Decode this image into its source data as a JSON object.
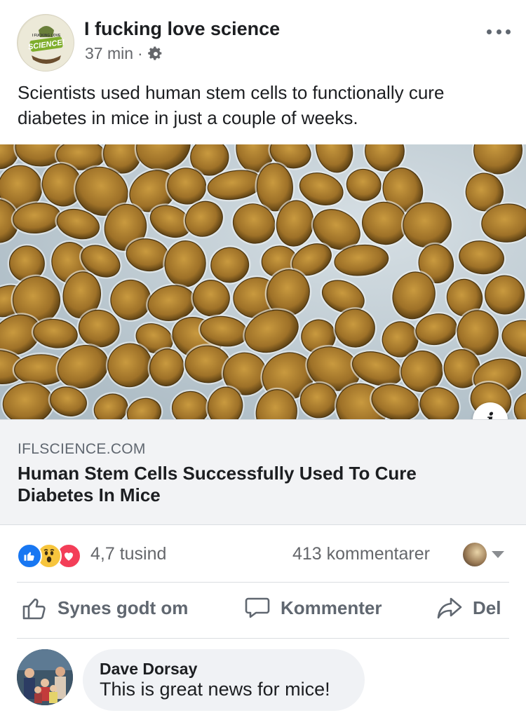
{
  "post": {
    "page_name": "I fucking love science",
    "time": "37 min",
    "separator": "·",
    "text": "Scientists used human stem cells to functionally cure diabetes in mice in just a couple of weeks.",
    "avatar_label": "SCIENCE!",
    "avatar_label_small": "I FUCKING LOVE"
  },
  "link": {
    "domain": "IFLSCIENCE.COM",
    "title": "Human Stem Cells Successfully Used To Cure Diabetes In Mice",
    "info_glyph": "i"
  },
  "stats": {
    "reactions": [
      "like",
      "wow",
      "love"
    ],
    "reaction_count": "4,7 tusind",
    "comment_count": "413 kommentarer"
  },
  "actions": {
    "like": "Synes godt om",
    "comment": "Kommenter",
    "share": "Del"
  },
  "comment": {
    "author": "Dave Dorsay",
    "text": "This is great news for mice!"
  },
  "colors": {
    "accent": "#1877f2",
    "wow": "#f7c53d",
    "love": "#f33e58",
    "secondary_text": "#65676b"
  }
}
